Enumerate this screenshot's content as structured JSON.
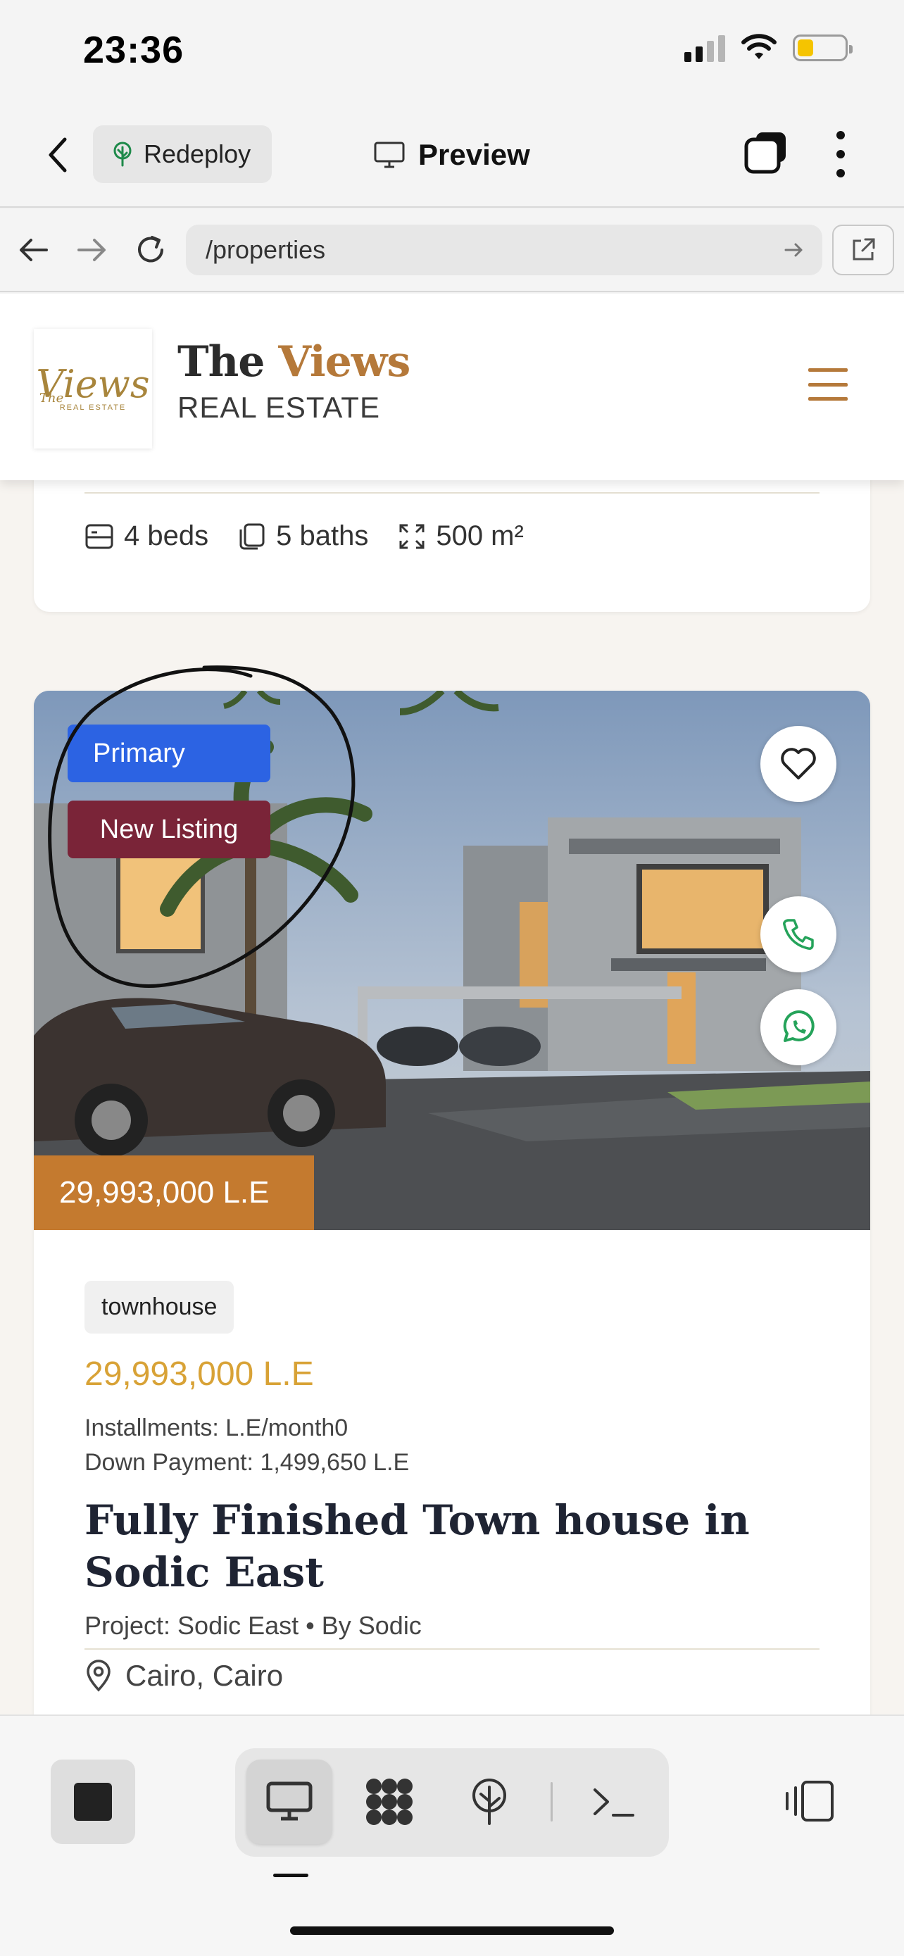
{
  "status_bar": {
    "time": "23:36",
    "battery_level": 0.34
  },
  "app_bar": {
    "redeploy_label": "Redeploy",
    "preview_label": "Preview"
  },
  "browser": {
    "url": "/properties"
  },
  "site": {
    "brand_main": "The ",
    "brand_accent": "Views",
    "brand_sub": "REAL ESTATE",
    "logo_the": "The",
    "logo_views": "Views",
    "logo_sub": "REAL ESTATE",
    "accent_color": "#b5793a"
  },
  "prev_card": {
    "beds": "4 beds",
    "baths": "5 baths",
    "area": "500 m²"
  },
  "listing": {
    "badge_primary": "Primary",
    "badge_new": "New Listing",
    "price_tag": "29,993,000 L.E",
    "type": "townhouse",
    "price": "29,993,000 L.E",
    "installments": "Installments: L.E/month0",
    "down_payment": "Down Payment: 1,499,650 L.E",
    "title": "Fully Finished Town house in Sodic East",
    "project": "Project: Sodic East  • By Sodic",
    "location": "Cairo, Cairo"
  },
  "icons": {
    "fav": "heart-icon",
    "call": "phone-icon",
    "whatsapp": "whatsapp-icon"
  }
}
